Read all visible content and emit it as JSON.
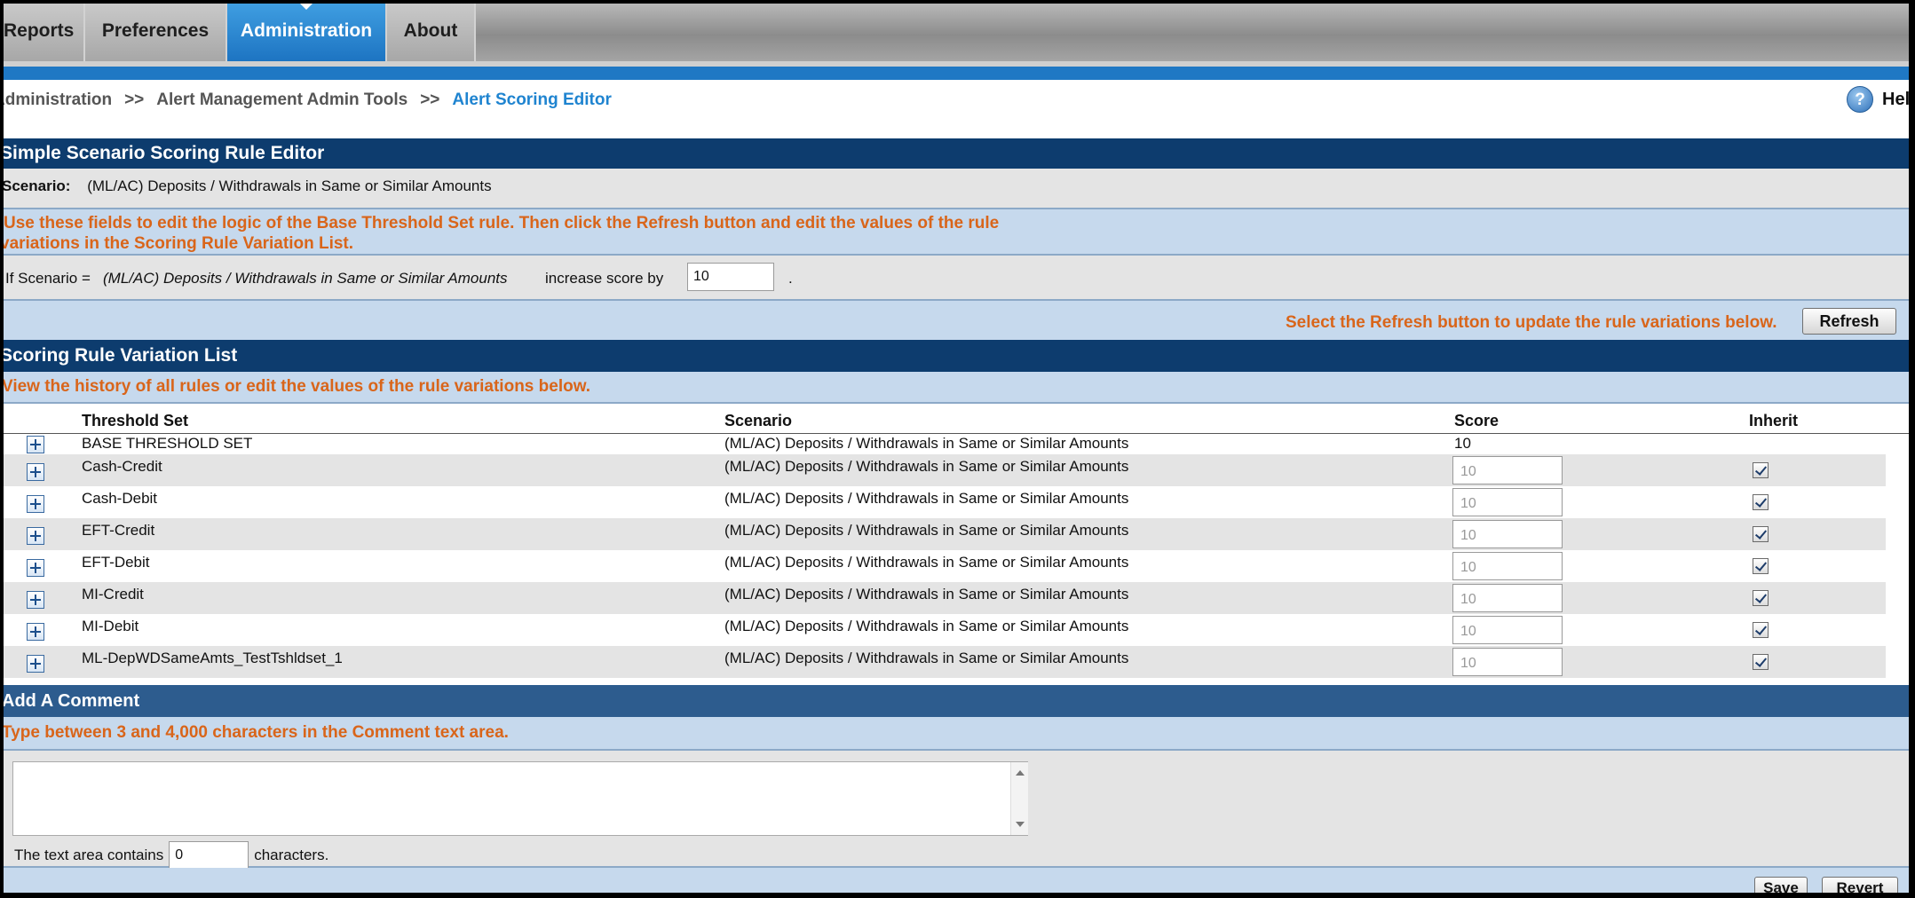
{
  "nav": {
    "tabs": [
      {
        "label": "Reports"
      },
      {
        "label": "Preferences"
      },
      {
        "label": "Administration",
        "active": true
      },
      {
        "label": "About"
      }
    ]
  },
  "breadcrumb": {
    "items": [
      "Administration",
      ">>",
      "Alert Management Admin Tools",
      ">>",
      "Alert Scoring Editor"
    ]
  },
  "help": {
    "label": "Help",
    "icon": "help-icon"
  },
  "editor": {
    "title": "Simple Scenario Scoring Rule Editor",
    "scenario_label": "Scenario:",
    "scenario_value": "(ML/AC) Deposits / Withdrawals in Same or Similar Amounts",
    "instructions_line1": "Use these fields to edit the logic of the Base Threshold Set rule. Then click the Refresh button and edit the values of the rule",
    "instructions_line2": "variations in the Scoring Rule Variation List.",
    "rule_prefix": "If Scenario =",
    "rule_scenario": "(ML/AC) Deposits / Withdrawals in Same or Similar Amounts",
    "rule_suffix": "increase score by",
    "rule_score": "10",
    "rule_end": ".",
    "refresh_hint": "Select the Refresh button to update the rule variations below.",
    "refresh_label": "Refresh"
  },
  "variations": {
    "title": "Scoring Rule Variation List",
    "instructions": "View the history of all rules or edit the values of the rule variations below.",
    "columns": [
      "Threshold Set",
      "Scenario",
      "Score",
      "Inherit"
    ],
    "base_row": {
      "threshold_set": "BASE THRESHOLD SET",
      "scenario": "(ML/AC) Deposits / Withdrawals in Same or Similar Amounts",
      "score": "10"
    },
    "rows": [
      {
        "threshold_set": "Cash-Credit",
        "scenario": "(ML/AC) Deposits / Withdrawals in Same or Similar Amounts",
        "score": "10",
        "inherit": true
      },
      {
        "threshold_set": "Cash-Debit",
        "scenario": "(ML/AC) Deposits / Withdrawals in Same or Similar Amounts",
        "score": "10",
        "inherit": true
      },
      {
        "threshold_set": "EFT-Credit",
        "scenario": "(ML/AC) Deposits / Withdrawals in Same or Similar Amounts",
        "score": "10",
        "inherit": true
      },
      {
        "threshold_set": "EFT-Debit",
        "scenario": "(ML/AC) Deposits / Withdrawals in Same or Similar Amounts",
        "score": "10",
        "inherit": true
      },
      {
        "threshold_set": "MI-Credit",
        "scenario": "(ML/AC) Deposits / Withdrawals in Same or Similar Amounts",
        "score": "10",
        "inherit": true
      },
      {
        "threshold_set": "MI-Debit",
        "scenario": "(ML/AC) Deposits / Withdrawals in Same or Similar Amounts",
        "score": "10",
        "inherit": true
      },
      {
        "threshold_set": "ML-DepWDSameAmts_TestTshldset_1",
        "scenario": "(ML/AC) Deposits / Withdrawals in Same or Similar Amounts",
        "score": "10",
        "inherit": true
      }
    ]
  },
  "comment": {
    "title": "Add A Comment",
    "instructions": "Type between 3 and 4,000 characters in the Comment text area.",
    "text": "",
    "count_prefix": "The text area contains",
    "count_value": "0",
    "count_suffix": "characters."
  },
  "actions": {
    "save_label": "Save",
    "revert_label": "Revert"
  },
  "colors": {
    "header": "#0d3c6e",
    "instruction_bg": "#c6d9ed",
    "instruction_text": "#d9651a",
    "active_tab": "#1f78c4"
  }
}
